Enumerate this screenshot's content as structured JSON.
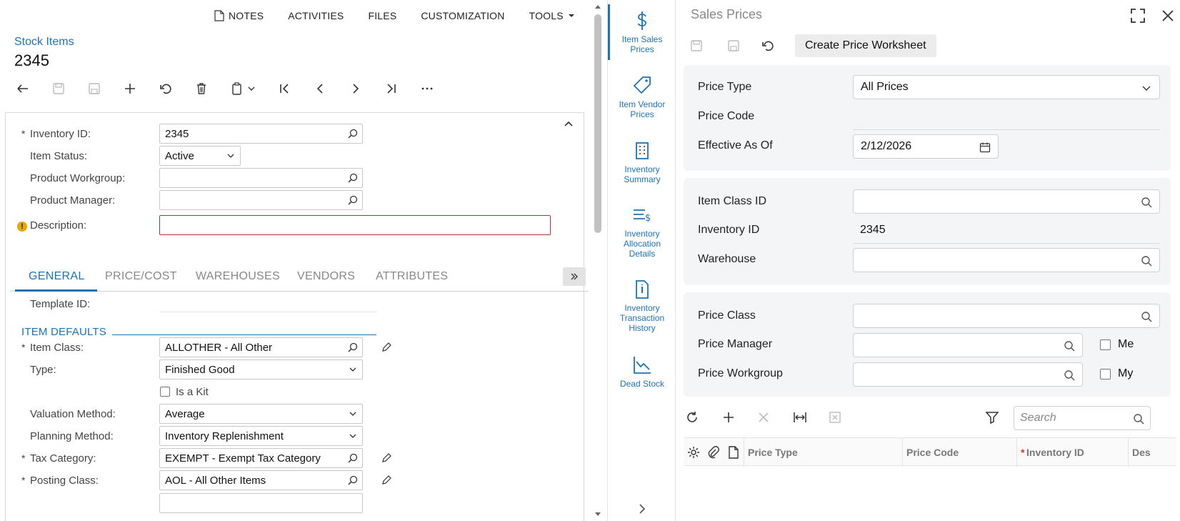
{
  "top_menu": {
    "notes": "NOTES",
    "activities": "ACTIVITIES",
    "files": "FILES",
    "customization": "CUSTOMIZATION",
    "tools": "TOOLS"
  },
  "breadcrumb": "Stock Items",
  "page_title": "2345",
  "form": {
    "inventory_id_label": "Inventory ID:",
    "inventory_id_value": "2345",
    "item_status_label": "Item Status:",
    "item_status_value": "Active",
    "product_workgroup_label": "Product Workgroup:",
    "product_manager_label": "Product Manager:",
    "description_label": "Description:"
  },
  "tabs": [
    "GENERAL",
    "PRICE/COST",
    "WAREHOUSES",
    "VENDORS",
    "ATTRIBUTES"
  ],
  "general": {
    "template_id_label": "Template ID:",
    "section_title": "ITEM DEFAULTS",
    "item_class_label": "Item Class:",
    "item_class_value": "ALLOTHER - All Other",
    "type_label": "Type:",
    "type_value": "Finished Good",
    "is_kit_label": "Is a Kit",
    "valuation_label": "Valuation Method:",
    "valuation_value": "Average",
    "planning_label": "Planning Method:",
    "planning_value": "Inventory Replenishment",
    "tax_label": "Tax Category:",
    "tax_value": "EXEMPT - Exempt Tax Category",
    "posting_label": "Posting Class:",
    "posting_value": "AOL - All Other Items"
  },
  "sidebar": {
    "item_sales_prices": [
      "Item Sales",
      "Prices"
    ],
    "item_vendor_prices": [
      "Item Vendor",
      "Prices"
    ],
    "inventory_summary": [
      "Inventory",
      "Summary"
    ],
    "inventory_allocation": [
      "Inventory",
      "Allocation",
      "Details"
    ],
    "inventory_transaction": [
      "Inventory",
      "Transaction",
      "History"
    ],
    "dead_stock": [
      "Dead Stock"
    ]
  },
  "right_panel": {
    "title": "Sales Prices",
    "create_worksheet": "Create Price Worksheet",
    "price_type_label": "Price Type",
    "price_type_value": "All Prices",
    "price_code_label": "Price Code",
    "effective_label": "Effective As Of",
    "effective_value": "2/12/2026",
    "item_class_label": "Item Class ID",
    "inventory_id_label": "Inventory ID",
    "inventory_id_value": "2345",
    "warehouse_label": "Warehouse",
    "price_class_label": "Price Class",
    "price_manager_label": "Price Manager",
    "me_label": "Me",
    "price_workgroup_label": "Price Workgroup",
    "my_label": "My",
    "search_placeholder": "Search",
    "columns": [
      "Price Type",
      "Price Code",
      "Inventory ID",
      "Des"
    ]
  },
  "colors": {
    "accent": "#1b73b9",
    "error": "#aa3333",
    "warning": "#e5a800"
  }
}
